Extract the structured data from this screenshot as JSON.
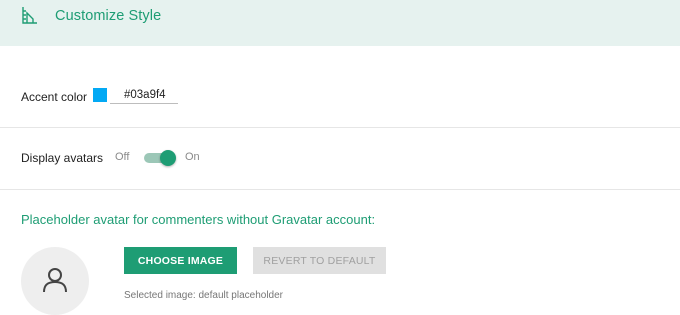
{
  "header": {
    "title": "Customize Style",
    "icon": "palette-ruler-icon"
  },
  "accent": {
    "label": "Accent color",
    "value": "#03a9f4",
    "swatch_color": "#03a9f4"
  },
  "avatars": {
    "label": "Display avatars",
    "off_label": "Off",
    "on_label": "On",
    "enabled": true
  },
  "placeholder": {
    "heading": "Placeholder avatar for commenters without Gravatar account:",
    "choose_label": "CHOOSE IMAGE",
    "revert_label": "REVERT TO DEFAULT",
    "selected_text": "Selected image: default placeholder"
  },
  "colors": {
    "brand": "#1e9d74",
    "header_bg": "#e6f2ef"
  }
}
